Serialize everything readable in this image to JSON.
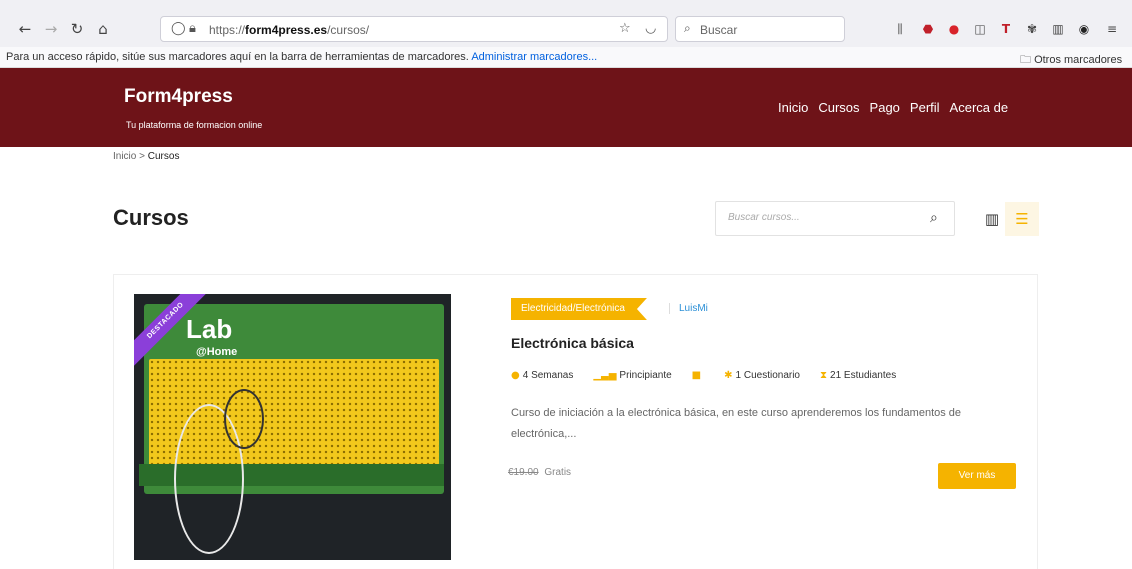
{
  "browser": {
    "url_prefix": "https://",
    "url_domain": "form4press.es",
    "url_path": "/cursos/",
    "search_placeholder": "Buscar",
    "bookmarks_hint": "Para un acceso rápido, sitúe sus marcadores aquí en la barra de herramientas de marcadores.",
    "bookmarks_manage": "Administrar marcadores...",
    "other_bookmarks": "Otros marcadores",
    "icons": [
      "back-icon",
      "forward-icon",
      "reload-icon",
      "home-icon",
      "shield-icon",
      "lock-icon",
      "star-icon",
      "pocket-icon",
      "library-icon",
      "ublock-icon",
      "extension-icon",
      "sidebar-icon",
      "menu-icon"
    ]
  },
  "site": {
    "brand": "Form4press",
    "tagline": "Tu plataforma de formacion online",
    "header_color": "#6e1318",
    "accent_color": "#f5b300",
    "nav": [
      "Inicio",
      "Cursos",
      "Pago",
      "Perfil",
      "Acerca de"
    ]
  },
  "breadcrumb": {
    "home": "Inicio",
    "separator": ">",
    "current": "Cursos"
  },
  "page": {
    "title": "Cursos",
    "search_placeholder": "Buscar cursos..."
  },
  "course": {
    "ribbon": "DESTACADO",
    "thumb_logo": "Lab",
    "thumb_logo_sub": "@Home",
    "category": "Electricidad/Electrónica",
    "author": "LuisMi",
    "title": "Electrónica básica",
    "duration": "4 Semanas",
    "level": "Principiante",
    "quizzes": "1 Cuestionario",
    "students": "21 Estudiantes",
    "description": "Curso de iniciación a la electrónica básica, en este curso aprenderemos los fundamentos de electrónica,...",
    "old_price": "€19.00",
    "price": "Gratis",
    "button": "Ver más"
  }
}
